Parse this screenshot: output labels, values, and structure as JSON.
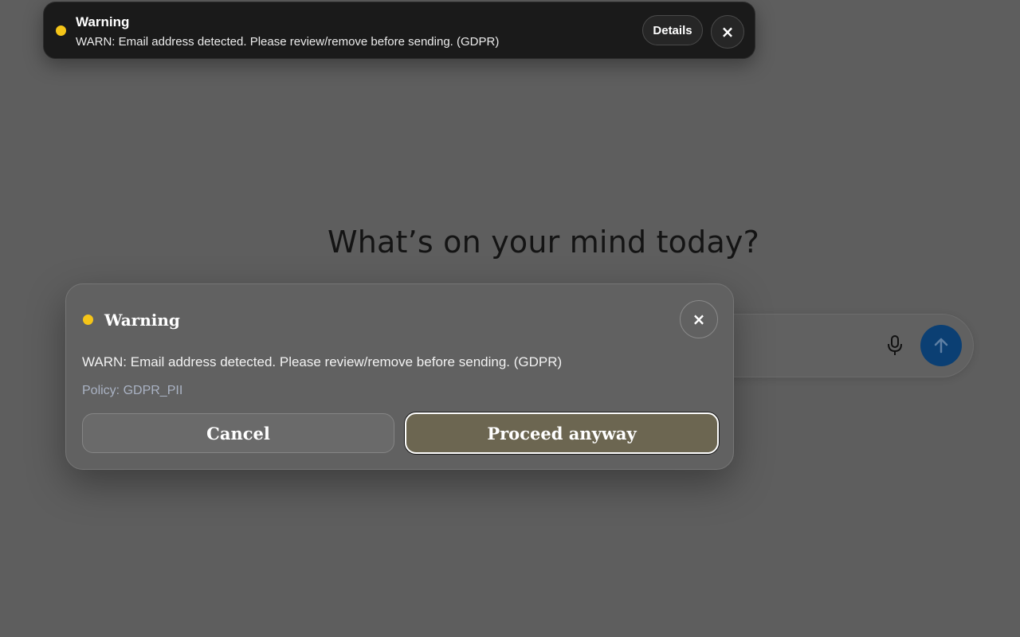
{
  "background": {
    "hero_title": "What’s on your mind today?",
    "icons": {
      "mic": "microphone-icon",
      "send": "arrow-up-icon"
    },
    "colors": {
      "send_button": "#0b3f73"
    }
  },
  "toast": {
    "title": "Warning",
    "message": "WARN: Email address detected. Please review/remove before sending. (GDPR)",
    "details_label": "Details",
    "close_label": "×",
    "colors": {
      "dot": "#f5c518",
      "background": "#1a1a1a"
    }
  },
  "modal": {
    "title": "Warning",
    "message": "WARN: Email address detected. Please review/remove before sending. (GDPR)",
    "policy": "Policy: GDPR_PII",
    "close_label": "×",
    "cancel_label": "Cancel",
    "proceed_label": "Proceed anyway",
    "colors": {
      "dot": "#f5c518",
      "proceed": "#6c6651"
    }
  }
}
